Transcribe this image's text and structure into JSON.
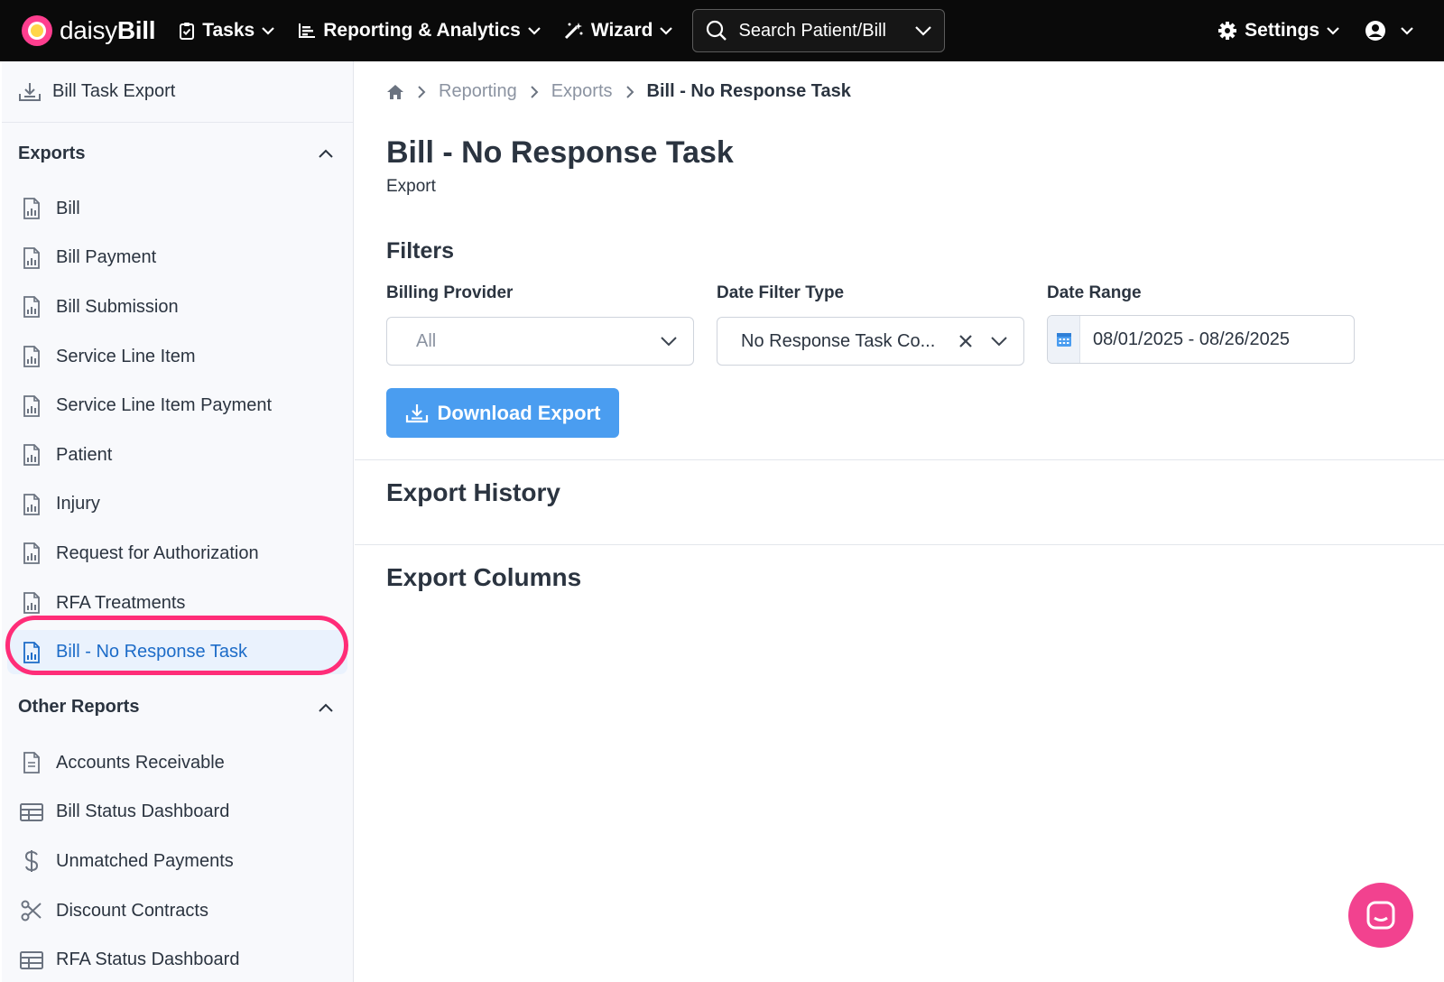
{
  "topbar": {
    "logo_prefix": "daisy",
    "logo_suffix": "Bill",
    "tasks": "Tasks",
    "reporting": "Reporting & Analytics",
    "wizard": "Wizard",
    "search": "Search Patient/Bill",
    "settings": "Settings"
  },
  "sidebar": {
    "top_item": "Bill Task Export",
    "exports_header": "Exports",
    "exports": [
      "Bill",
      "Bill Payment",
      "Bill Submission",
      "Service Line Item",
      "Service Line Item Payment",
      "Patient",
      "Injury",
      "Request for Authorization",
      "RFA Treatments",
      "Bill - No Response Task"
    ],
    "other_header": "Other Reports",
    "other": [
      {
        "label": "Accounts Receivable",
        "icon": "document-icon"
      },
      {
        "label": "Bill Status Dashboard",
        "icon": "table-icon"
      },
      {
        "label": "Unmatched Payments",
        "icon": "dollar-icon"
      },
      {
        "label": "Discount Contracts",
        "icon": "scissors-icon"
      },
      {
        "label": "RFA Status Dashboard",
        "icon": "table-icon"
      }
    ]
  },
  "breadcrumb": {
    "reporting": "Reporting",
    "exports": "Exports",
    "current": "Bill - No Response Task"
  },
  "page": {
    "title": "Bill - No Response Task",
    "subtitle": "Export"
  },
  "filters": {
    "title": "Filters",
    "billing_provider_label": "Billing Provider",
    "billing_provider_value": "All",
    "date_filter_type_label": "Date Filter Type",
    "date_filter_type_value": "No Response Task Co...",
    "date_range_label": "Date Range",
    "date_range_value": "08/01/2025 - 08/26/2025"
  },
  "download_button": "Download Export",
  "export_history_title": "Export History",
  "export_columns_title": "Export Columns",
  "colors": {
    "topbar": "#0a0a0a",
    "accent": "#4a9df0",
    "active_link": "#1d6cc8",
    "highlight": "#ff2d78",
    "chat": "#f2428f"
  }
}
